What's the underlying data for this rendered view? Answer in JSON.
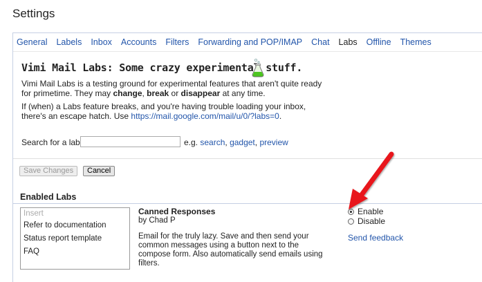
{
  "header": {
    "title": "Settings"
  },
  "tabs": [
    {
      "label": "General"
    },
    {
      "label": "Labels"
    },
    {
      "label": "Inbox"
    },
    {
      "label": "Accounts"
    },
    {
      "label": "Filters"
    },
    {
      "label": "Forwarding and POP/IMAP"
    },
    {
      "label": "Chat"
    },
    {
      "label": "Labs",
      "active": true
    },
    {
      "label": "Offline"
    },
    {
      "label": "Themes"
    }
  ],
  "labs": {
    "heading": "Vimi Mail Labs: Some crazy experimental stuff.",
    "intro_1": "Vimi Mail Labs is a testing ground for experimental features that aren't quite ready for primetime. They may ",
    "intro_change": "change",
    "intro_sep1": ", ",
    "intro_break": "break",
    "intro_sep2": " or ",
    "intro_disappear": "disappear",
    "intro_end": " at any time.",
    "escape_text": "If (when) a Labs feature breaks, and you're having trouble loading your inbox, there's an escape hatch. Use ",
    "escape_link": "https://mail.google.com/mail/u/0/?labs=0",
    "escape_end": ".",
    "search_label": "Search for a lab:",
    "search_value": "",
    "eg_label": "e.g.",
    "eg_search": "search",
    "eg_comma1": ", ",
    "eg_gadget": "gadget",
    "eg_comma2": ", ",
    "eg_preview": "preview"
  },
  "buttons": {
    "save": "Save Changes",
    "cancel": "Cancel"
  },
  "enabled": {
    "heading": "Enabled Labs",
    "list": [
      "Insert",
      "Refer to documentation",
      "Status report template",
      "FAQ"
    ],
    "lab_title": "Canned Responses",
    "lab_author": "by Chad P",
    "lab_desc": "Email for the truly lazy. Save and then send your common messages using a button next to the compose form. Also automatically send emails using filters.",
    "enable_label": "Enable",
    "disable_label": "Disable",
    "selected": "Enable",
    "feedback": "Send feedback"
  },
  "colors": {
    "link": "#2255aa",
    "arrow": "#e8191e",
    "border": "#c5cfe3"
  }
}
